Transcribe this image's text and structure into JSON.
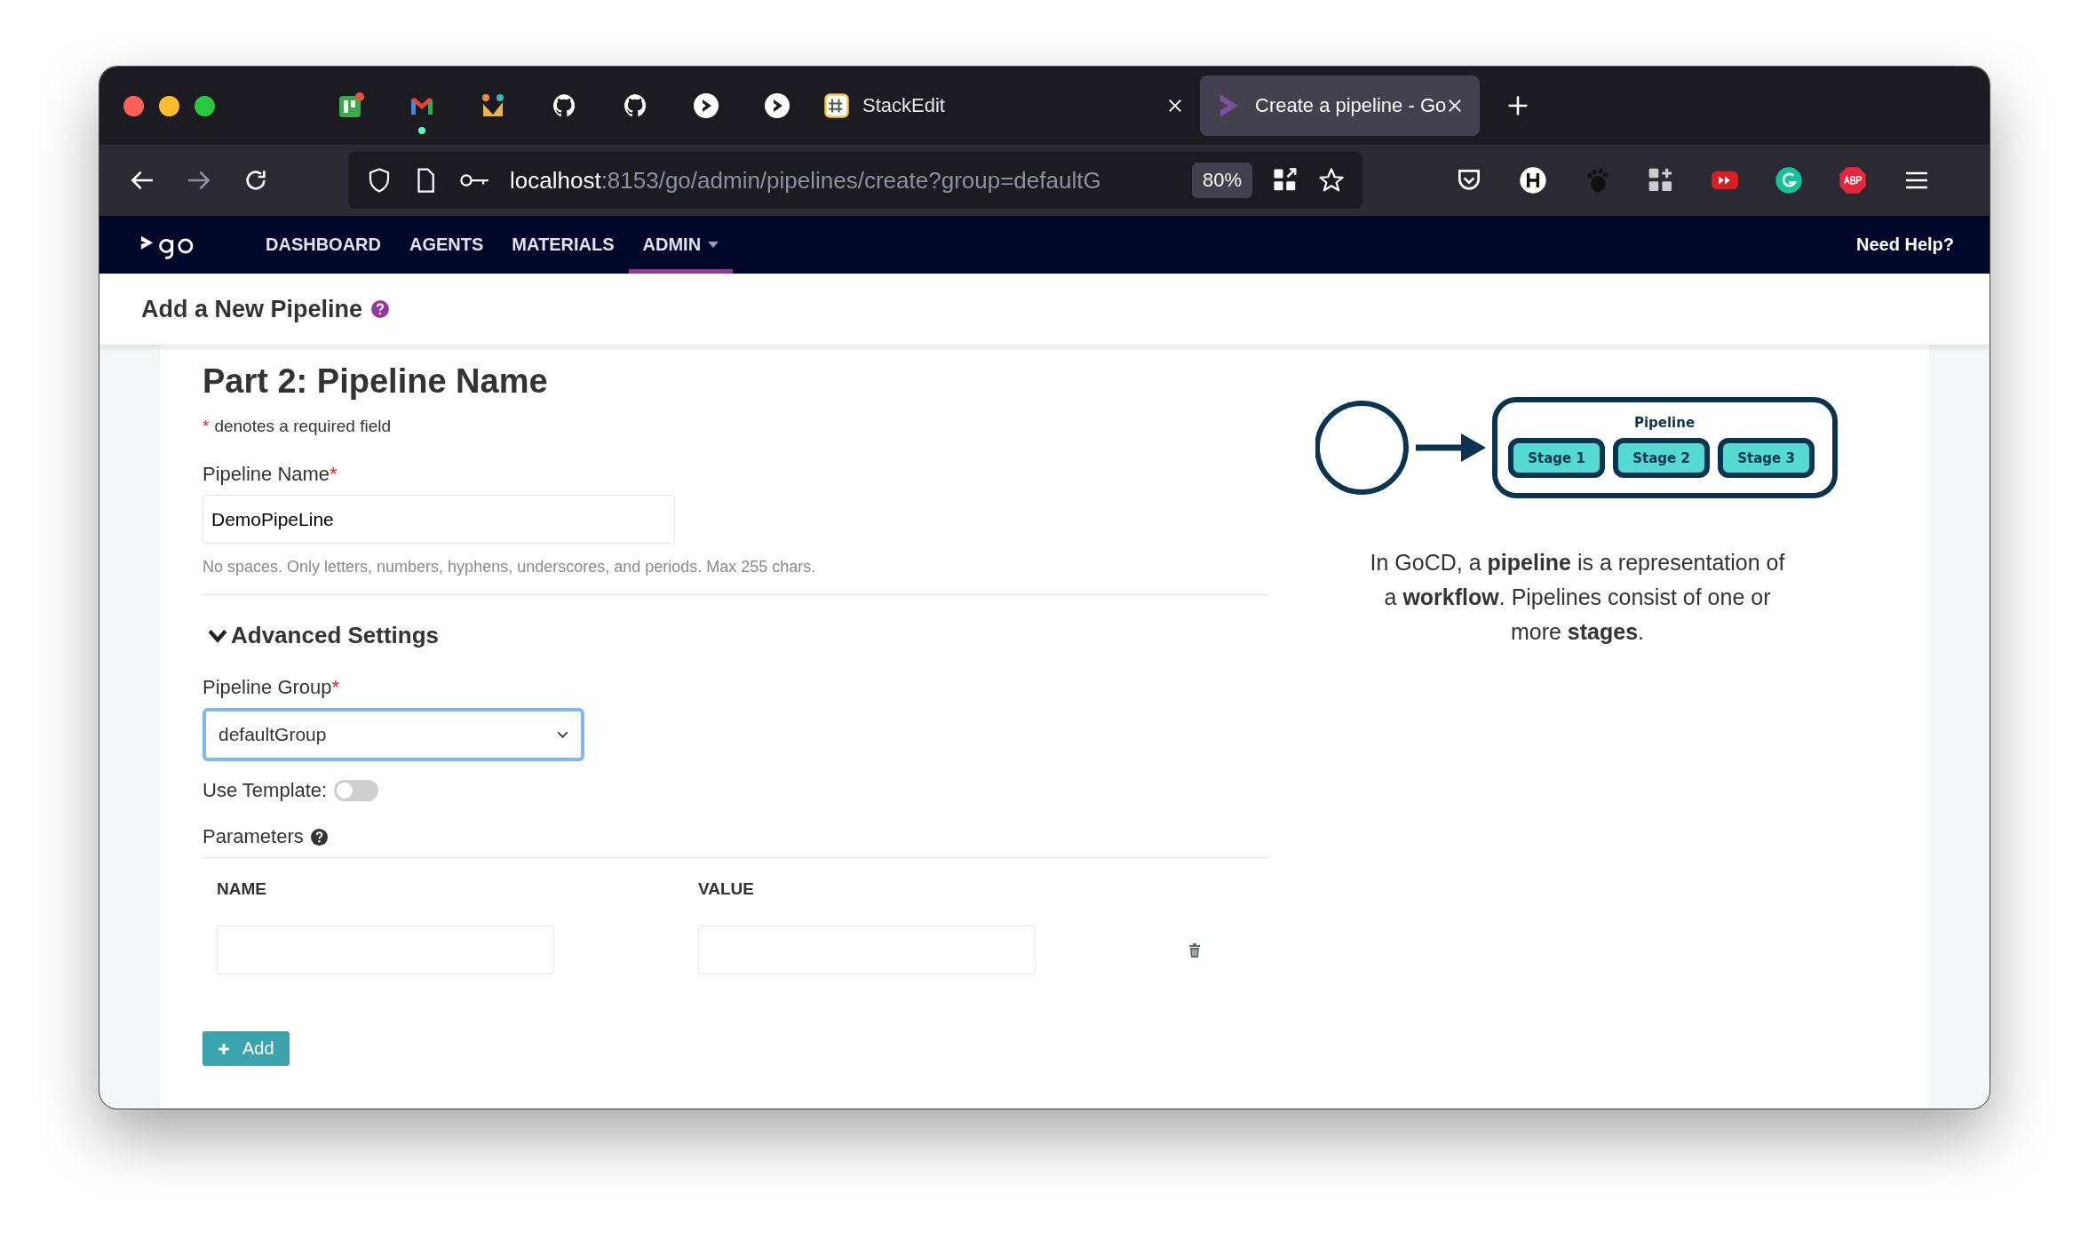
{
  "browser": {
    "tabs": [
      {
        "title": "StackEdit",
        "selected": false
      },
      {
        "title": "Create a pipeline - Go",
        "selected": true
      }
    ],
    "url_host": "localhost",
    "url_rest": ":8153/go/admin/pipelines/create?group=defaultG",
    "zoom": "80%"
  },
  "nav": {
    "items": [
      {
        "label": "DASHBOARD",
        "selected": false
      },
      {
        "label": "AGENTS",
        "selected": false
      },
      {
        "label": "MATERIALS",
        "selected": false
      },
      {
        "label": "ADMIN",
        "selected": true
      }
    ],
    "help": "Need Help?"
  },
  "page_title": "Add a New Pipeline",
  "form": {
    "heading": "Part 2: Pipeline Name",
    "required_mark": "*",
    "required_note": "denotes a required field",
    "name_label": "Pipeline Name",
    "name_value": "DemoPipeLine",
    "name_hint": "No spaces. Only letters, numbers, hyphens, underscores, and periods. Max 255 chars.",
    "advanced": {
      "title": "Advanced Settings",
      "expanded": true,
      "group_label": "Pipeline Group",
      "group_value": "defaultGroup",
      "template_label": "Use Template:",
      "template_on": false,
      "parameters_title": "Parameters",
      "columns": [
        "NAME",
        "VALUE"
      ],
      "add_label": "Add"
    }
  },
  "diagram": {
    "pipeline_label": "Pipeline",
    "stages": [
      "Stage 1",
      "Stage 2",
      "Stage 3"
    ]
  },
  "description": "In GoCD, a **pipeline** is a representation of a **workflow**. Pipelines consist of one or more **stages**."
}
